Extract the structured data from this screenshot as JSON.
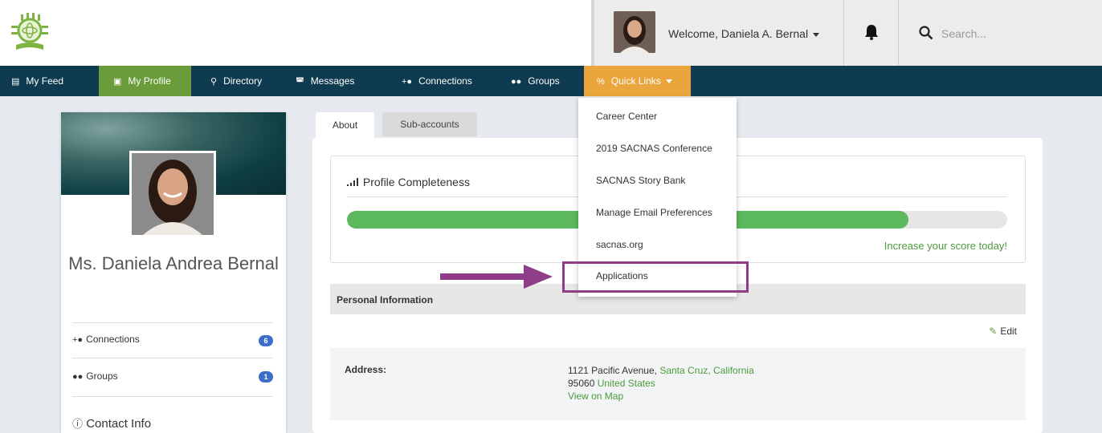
{
  "header": {
    "welcome": "Welcome, Daniela A. Bernal",
    "search_placeholder": "Search..."
  },
  "nav": {
    "items": [
      {
        "label": "My Feed",
        "icon": "newspaper-icon"
      },
      {
        "label": "My Profile",
        "icon": "id-card-icon",
        "active": true
      },
      {
        "label": "Directory",
        "icon": "search-icon"
      },
      {
        "label": "Messages",
        "icon": "inbox-icon"
      },
      {
        "label": "Connections",
        "icon": "user-plus-icon"
      },
      {
        "label": "Groups",
        "icon": "users-icon"
      },
      {
        "label": "Quick Links",
        "icon": "link-icon"
      }
    ]
  },
  "quick_links": {
    "items": [
      "Career Center",
      "2019 SACNAS Conference",
      "SACNAS Story Bank",
      "Manage Email Preferences",
      "sacnas.org",
      "Applications"
    ]
  },
  "profile_card": {
    "name": "Ms. Daniela Andrea Bernal",
    "connections_label": "Connections",
    "connections_count": "6",
    "groups_label": "Groups",
    "groups_count": "1",
    "contact_label": "Contact Info"
  },
  "tabs": {
    "about": "About",
    "sub_accounts": "Sub-accounts"
  },
  "completeness": {
    "title": "Profile Completeness",
    "progress_percent": 85,
    "cta": "Increase your score today!"
  },
  "personal_info": {
    "title": "Personal Information",
    "edit_label": "Edit",
    "address_label": "Address:",
    "street": "1121 Pacific Avenue,",
    "city": "Santa Cruz,",
    "state": "California",
    "zip": "95060",
    "country": "United States",
    "map_link": "View on Map"
  },
  "colors": {
    "nav_bg": "#0e3b50",
    "active_tab": "#6a9c3a",
    "quick_links": "#eaa63c",
    "progress": "#5cb85c",
    "highlight": "#8e3d86"
  }
}
